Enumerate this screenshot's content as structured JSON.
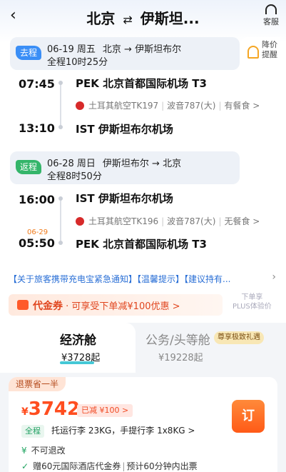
{
  "header": {
    "title_from": "北京",
    "title_to": "伊斯坦...",
    "swap_symbol": "⇄",
    "service_label": "客服"
  },
  "outbound": {
    "tag": "去程",
    "date": "06-19 周五",
    "route": "北京 → 伊斯坦布尔",
    "duration": "全程10时25分",
    "dep_time": "07:45",
    "dep_airport": "PEK 北京首都国际机场 T3",
    "airline": "土耳其航空TK197",
    "aircraft": "波音787(大)",
    "meal": "有餐食 >",
    "arr_time": "13:10",
    "arr_airport": "IST 伊斯坦布尔机场"
  },
  "price_alert": {
    "label": "降价提醒"
  },
  "return": {
    "tag": "返程",
    "date": "06-28 周日",
    "route": "伊斯坦布尔 → 北京",
    "duration": "全程8时50分",
    "dep_time": "16:00",
    "dep_airport": "IST 伊斯坦布尔机场",
    "airline": "土耳其航空TK196",
    "aircraft": "波音787(大)",
    "meal": "无餐食 >",
    "arr_time": "05:50",
    "arr_date": "06-29",
    "arr_airport": "PEK 北京首都国际机场 T3"
  },
  "notices": "【关于旅客携带充电宝紧急通知】【温馨提示】【建议持有...",
  "coupon": {
    "title": "代金券",
    "text": "· 可享受下单减¥100优惠 >"
  },
  "plus": {
    "line1": "下单享",
    "line2": "PLUS体验价"
  },
  "cabins": [
    {
      "name": "经济舱",
      "price": "¥3728起"
    },
    {
      "name": "公务/头等舱",
      "price": "¥19228起",
      "badge": "尊享极致礼遇"
    }
  ],
  "fare": {
    "refund_tag": "退票省一半",
    "currency": "¥",
    "price": "3742",
    "discount": "已减 ¥100 >",
    "baggage_tag": "全程",
    "baggage": "托运行李 23KG，手提行李 1x8KG >",
    "book_label": "订",
    "rule1": "不可退改",
    "rule2": "赠60元国际酒店代金券",
    "rule2b": "预计60分钟内出票"
  },
  "colors": {
    "accent": "#ff5a17",
    "link": "#2a6fd6",
    "go_tag": "#3a8ef6",
    "ret_tag": "#34b56a"
  }
}
